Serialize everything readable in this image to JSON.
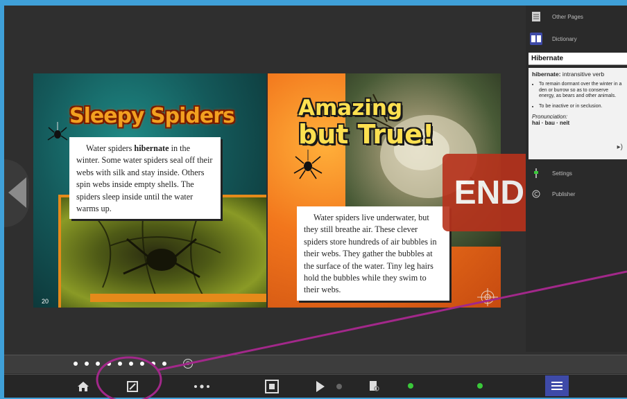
{
  "book": {
    "left_page": {
      "title": "Sleepy Spiders",
      "body_pre": "Water spiders ",
      "body_bold": "hibernate",
      "body_post": " in the winter. Some water spiders seal off their webs with silk and stay inside. Others spin webs inside empty shells. The spiders sleep inside until the water warms up.",
      "page_number": "20"
    },
    "right_page": {
      "title_line1": "Amazing",
      "title_line2": "but True!",
      "body": "Water spiders live underwater, but they still breathe air. These clever spiders store hundreds of air bubbles in their webs. They gather the bubbles at the surface of the water. Tiny leg hairs hold the bubbles while they swim to their webs."
    },
    "end_label": "END"
  },
  "sidebar": {
    "other_pages": "Other Pages",
    "dictionary": "Dictionary",
    "search_value": "Hibernate",
    "entry_word": "hibernate:",
    "entry_pos": " intransitive verb",
    "definitions": [
      "To remain dormant over the winter in a den or burrow so as to conserve energy, as bears and other animals.",
      "To be inactive or in seclusion."
    ],
    "pronunciation_label": "Pronunciation:",
    "pronunciation": "hai · bau · neit",
    "settings": "Settings",
    "publisher": "Publisher"
  },
  "progress": {
    "dot_count": 9,
    "end_marker": "©"
  },
  "colors": {
    "accent_blue": "#3e4aa8",
    "annotation_magenta": "#a2288a",
    "led_green": "#3ac83a"
  }
}
